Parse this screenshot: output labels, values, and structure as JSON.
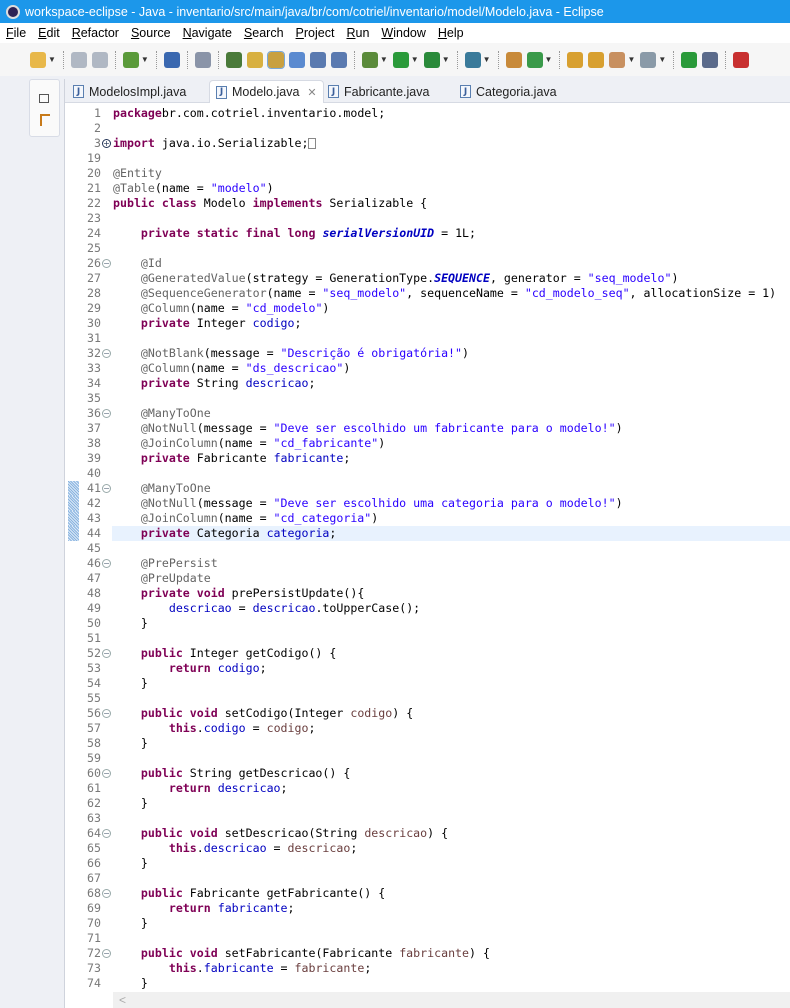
{
  "window": {
    "title": "workspace-eclipse - Java - inventario/src/main/java/br/com/cotriel/inventario/model/Modelo.java - Eclipse"
  },
  "menu": [
    "File",
    "Edit",
    "Refactor",
    "Source",
    "Navigate",
    "Search",
    "Project",
    "Run",
    "Window",
    "Help"
  ],
  "toolbar": [
    "new-icon",
    "save-icon",
    "save-all-icon",
    "build-icon",
    "console-icon",
    "skip-breakpoints-icon",
    "search-icon",
    "mark-occurrences-icon",
    "block-selection-icon",
    "open-type-icon",
    "toggle-word-wrap-icon",
    "show-whitespace-icon",
    "debug-icon",
    "run-icon",
    "run-external-tool-icon",
    "server-icon",
    "new-java-project-icon",
    "new-class-icon",
    "open-folder-icon",
    "open-package-icon",
    "pencil-icon",
    "jar-icon",
    "resume-icon",
    "step-icon",
    "stop-icon"
  ],
  "tabs": [
    {
      "label": "ModelosImpl.java",
      "active": false
    },
    {
      "label": "Modelo.java",
      "active": true
    },
    {
      "label": "Fabricante.java",
      "active": false
    },
    {
      "label": "Categoria.java",
      "active": false
    }
  ],
  "colors": {
    "keyword": "#7f0055",
    "string": "#2a00ff",
    "annotation": "#646464",
    "field": "#0000c0",
    "param": "#6a3e3e",
    "titlebar": "#1c97ea"
  },
  "code": {
    "current_line": "44",
    "lines": [
      {
        "n": "1",
        "t": [
          [
            "k",
            "package"
          ],
          [
            "",
            "br.com.cotriel.inventario.model;"
          ]
        ]
      },
      {
        "n": "2",
        "t": []
      },
      {
        "n": "3",
        "fold": "+",
        "folded": true,
        "t": [
          [
            "k",
            "import"
          ],
          [
            "",
            " java.io.Serializable;"
          ]
        ]
      },
      {
        "n": "19",
        "t": []
      },
      {
        "n": "20",
        "t": [
          [
            "a",
            "@Entity"
          ]
        ]
      },
      {
        "n": "21",
        "t": [
          [
            "a",
            "@Table"
          ],
          [
            "",
            "(name = "
          ],
          [
            "s",
            "\"modelo\""
          ],
          [
            "",
            ")"
          ]
        ]
      },
      {
        "n": "22",
        "t": [
          [
            "k",
            "public"
          ],
          [
            "",
            " "
          ],
          [
            "k",
            "class"
          ],
          [
            "",
            " Modelo "
          ],
          [
            "k",
            "implements"
          ],
          [
            "",
            " Serializable {"
          ]
        ]
      },
      {
        "n": "23",
        "t": []
      },
      {
        "n": "24",
        "t": [
          [
            "",
            "    "
          ],
          [
            "k",
            "private"
          ],
          [
            "",
            " "
          ],
          [
            "k",
            "static"
          ],
          [
            "",
            " "
          ],
          [
            "k",
            "final"
          ],
          [
            "",
            " "
          ],
          [
            "k",
            "long"
          ],
          [
            "",
            " "
          ],
          [
            "sf",
            "serialVersionUID"
          ],
          [
            "",
            " = 1L;"
          ]
        ]
      },
      {
        "n": "25",
        "t": []
      },
      {
        "n": "26",
        "fold": "-",
        "t": [
          [
            "",
            "    "
          ],
          [
            "a",
            "@Id"
          ]
        ]
      },
      {
        "n": "27",
        "t": [
          [
            "",
            "    "
          ],
          [
            "a",
            "@GeneratedValue"
          ],
          [
            "",
            "(strategy = GenerationType."
          ],
          [
            "sf",
            "SEQUENCE"
          ],
          [
            "",
            ", generator = "
          ],
          [
            "s",
            "\"seq_modelo\""
          ],
          [
            "",
            ")"
          ]
        ]
      },
      {
        "n": "28",
        "t": [
          [
            "",
            "    "
          ],
          [
            "a",
            "@SequenceGenerator"
          ],
          [
            "",
            "(name = "
          ],
          [
            "s",
            "\"seq_modelo\""
          ],
          [
            "",
            ", sequenceName = "
          ],
          [
            "s",
            "\"cd_modelo_seq\""
          ],
          [
            "",
            ", allocationSize = 1)"
          ]
        ]
      },
      {
        "n": "29",
        "t": [
          [
            "",
            "    "
          ],
          [
            "a",
            "@Column"
          ],
          [
            "",
            "(name = "
          ],
          [
            "s",
            "\"cd_modelo\""
          ],
          [
            "",
            ")"
          ]
        ]
      },
      {
        "n": "30",
        "t": [
          [
            "",
            "    "
          ],
          [
            "k",
            "private"
          ],
          [
            "",
            " Integer "
          ],
          [
            "f",
            "codigo"
          ],
          [
            "",
            ";"
          ]
        ]
      },
      {
        "n": "31",
        "t": []
      },
      {
        "n": "32",
        "fold": "-",
        "t": [
          [
            "",
            "    "
          ],
          [
            "a",
            "@NotBlank"
          ],
          [
            "",
            "(message = "
          ],
          [
            "s",
            "\"Descrição é obrigatória!\""
          ],
          [
            "",
            ")"
          ]
        ]
      },
      {
        "n": "33",
        "t": [
          [
            "",
            "    "
          ],
          [
            "a",
            "@Column"
          ],
          [
            "",
            "(name = "
          ],
          [
            "s",
            "\"ds_descricao\""
          ],
          [
            "",
            ")"
          ]
        ]
      },
      {
        "n": "34",
        "t": [
          [
            "",
            "    "
          ],
          [
            "k",
            "private"
          ],
          [
            "",
            " String "
          ],
          [
            "f",
            "descricao"
          ],
          [
            "",
            ";"
          ]
        ]
      },
      {
        "n": "35",
        "t": []
      },
      {
        "n": "36",
        "fold": "-",
        "t": [
          [
            "",
            "    "
          ],
          [
            "a",
            "@ManyToOne"
          ]
        ]
      },
      {
        "n": "37",
        "t": [
          [
            "",
            "    "
          ],
          [
            "a",
            "@NotNull"
          ],
          [
            "",
            "(message = "
          ],
          [
            "s",
            "\"Deve ser escolhido um fabricante para o modelo!\""
          ],
          [
            "",
            ")"
          ]
        ]
      },
      {
        "n": "38",
        "t": [
          [
            "",
            "    "
          ],
          [
            "a",
            "@JoinColumn"
          ],
          [
            "",
            "(name = "
          ],
          [
            "s",
            "\"cd_fabricante\""
          ],
          [
            "",
            ")"
          ]
        ]
      },
      {
        "n": "39",
        "t": [
          [
            "",
            "    "
          ],
          [
            "k",
            "private"
          ],
          [
            "",
            " Fabricante "
          ],
          [
            "f",
            "fabricante"
          ],
          [
            "",
            ";"
          ]
        ]
      },
      {
        "n": "40",
        "t": []
      },
      {
        "n": "41",
        "fold": "-",
        "mark": true,
        "t": [
          [
            "",
            "    "
          ],
          [
            "a",
            "@ManyToOne"
          ]
        ]
      },
      {
        "n": "42",
        "mark": true,
        "t": [
          [
            "",
            "    "
          ],
          [
            "a",
            "@NotNull"
          ],
          [
            "",
            "(message = "
          ],
          [
            "s",
            "\"Deve ser escolhido uma categoria para o modelo!\""
          ],
          [
            "",
            ")"
          ]
        ]
      },
      {
        "n": "43",
        "mark": true,
        "t": [
          [
            "",
            "    "
          ],
          [
            "a",
            "@JoinColumn"
          ],
          [
            "",
            "(name = "
          ],
          [
            "s",
            "\"cd_categoria\""
          ],
          [
            "",
            ")"
          ]
        ]
      },
      {
        "n": "44",
        "mark": true,
        "t": [
          [
            "",
            "    "
          ],
          [
            "k",
            "private"
          ],
          [
            "",
            " Categoria "
          ],
          [
            "f",
            "categoria"
          ],
          [
            "",
            ";"
          ]
        ]
      },
      {
        "n": "45",
        "t": []
      },
      {
        "n": "46",
        "fold": "-",
        "t": [
          [
            "",
            "    "
          ],
          [
            "a",
            "@PrePersist"
          ]
        ]
      },
      {
        "n": "47",
        "t": [
          [
            "",
            "    "
          ],
          [
            "a",
            "@PreUpdate"
          ]
        ]
      },
      {
        "n": "48",
        "t": [
          [
            "",
            "    "
          ],
          [
            "k",
            "private"
          ],
          [
            "",
            " "
          ],
          [
            "k",
            "void"
          ],
          [
            "",
            " prePersistUpdate(){"
          ]
        ]
      },
      {
        "n": "49",
        "t": [
          [
            "",
            "        "
          ],
          [
            "f",
            "descricao"
          ],
          [
            "",
            " = "
          ],
          [
            "f",
            "descricao"
          ],
          [
            "",
            ".toUpperCase();"
          ]
        ]
      },
      {
        "n": "50",
        "t": [
          [
            "",
            "    }"
          ]
        ]
      },
      {
        "n": "51",
        "t": []
      },
      {
        "n": "52",
        "fold": "-",
        "t": [
          [
            "",
            "    "
          ],
          [
            "k",
            "public"
          ],
          [
            "",
            " Integer getCodigo() {"
          ]
        ]
      },
      {
        "n": "53",
        "t": [
          [
            "",
            "        "
          ],
          [
            "k",
            "return"
          ],
          [
            "",
            " "
          ],
          [
            "f",
            "codigo"
          ],
          [
            "",
            ";"
          ]
        ]
      },
      {
        "n": "54",
        "t": [
          [
            "",
            "    }"
          ]
        ]
      },
      {
        "n": "55",
        "t": []
      },
      {
        "n": "56",
        "fold": "-",
        "t": [
          [
            "",
            "    "
          ],
          [
            "k",
            "public"
          ],
          [
            "",
            " "
          ],
          [
            "k",
            "void"
          ],
          [
            "",
            " setCodigo(Integer "
          ],
          [
            "p",
            "codigo"
          ],
          [
            "",
            ") {"
          ]
        ]
      },
      {
        "n": "57",
        "t": [
          [
            "",
            "        "
          ],
          [
            "k",
            "this"
          ],
          [
            "",
            "."
          ],
          [
            "f",
            "codigo"
          ],
          [
            "",
            " = "
          ],
          [
            "p",
            "codigo"
          ],
          [
            "",
            ";"
          ]
        ]
      },
      {
        "n": "58",
        "t": [
          [
            "",
            "    }"
          ]
        ]
      },
      {
        "n": "59",
        "t": []
      },
      {
        "n": "60",
        "fold": "-",
        "t": [
          [
            "",
            "    "
          ],
          [
            "k",
            "public"
          ],
          [
            "",
            " String getDescricao() {"
          ]
        ]
      },
      {
        "n": "61",
        "t": [
          [
            "",
            "        "
          ],
          [
            "k",
            "return"
          ],
          [
            "",
            " "
          ],
          [
            "f",
            "descricao"
          ],
          [
            "",
            ";"
          ]
        ]
      },
      {
        "n": "62",
        "t": [
          [
            "",
            "    }"
          ]
        ]
      },
      {
        "n": "63",
        "t": []
      },
      {
        "n": "64",
        "fold": "-",
        "t": [
          [
            "",
            "    "
          ],
          [
            "k",
            "public"
          ],
          [
            "",
            " "
          ],
          [
            "k",
            "void"
          ],
          [
            "",
            " setDescricao(String "
          ],
          [
            "p",
            "descricao"
          ],
          [
            "",
            ") {"
          ]
        ]
      },
      {
        "n": "65",
        "t": [
          [
            "",
            "        "
          ],
          [
            "k",
            "this"
          ],
          [
            "",
            "."
          ],
          [
            "f",
            "descricao"
          ],
          [
            "",
            " = "
          ],
          [
            "p",
            "descricao"
          ],
          [
            "",
            ";"
          ]
        ]
      },
      {
        "n": "66",
        "t": [
          [
            "",
            "    }"
          ]
        ]
      },
      {
        "n": "67",
        "t": []
      },
      {
        "n": "68",
        "fold": "-",
        "t": [
          [
            "",
            "    "
          ],
          [
            "k",
            "public"
          ],
          [
            "",
            " Fabricante getFabricante() {"
          ]
        ]
      },
      {
        "n": "69",
        "t": [
          [
            "",
            "        "
          ],
          [
            "k",
            "return"
          ],
          [
            "",
            " "
          ],
          [
            "f",
            "fabricante"
          ],
          [
            "",
            ";"
          ]
        ]
      },
      {
        "n": "70",
        "t": [
          [
            "",
            "    }"
          ]
        ]
      },
      {
        "n": "71",
        "t": []
      },
      {
        "n": "72",
        "fold": "-",
        "t": [
          [
            "",
            "    "
          ],
          [
            "k",
            "public"
          ],
          [
            "",
            " "
          ],
          [
            "k",
            "void"
          ],
          [
            "",
            " setFabricante(Fabricante "
          ],
          [
            "p",
            "fabricante"
          ],
          [
            "",
            ") {"
          ]
        ]
      },
      {
        "n": "73",
        "t": [
          [
            "",
            "        "
          ],
          [
            "k",
            "this"
          ],
          [
            "",
            "."
          ],
          [
            "f",
            "fabricante"
          ],
          [
            "",
            " = "
          ],
          [
            "p",
            "fabricante"
          ],
          [
            "",
            ";"
          ]
        ]
      },
      {
        "n": "74",
        "t": [
          [
            "",
            "    }"
          ]
        ]
      }
    ]
  },
  "scroll": {
    "left_arrow": "<"
  }
}
